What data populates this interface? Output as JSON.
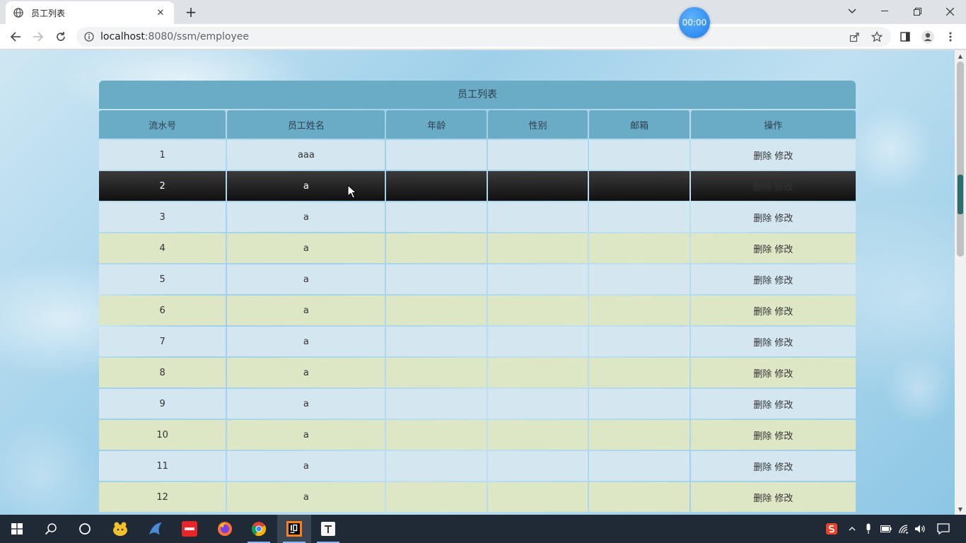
{
  "browser": {
    "tab_title": "员工列表",
    "tab_close": "✕",
    "new_tab": "+",
    "url_host": "localhost",
    "url_rest": ":8080/ssm/employee",
    "timer": "00:00"
  },
  "table": {
    "caption": "员工列表",
    "headers": [
      "流水号",
      "员工姓名",
      "年龄",
      "性别",
      "邮箱",
      "操作"
    ],
    "rows": [
      {
        "id": "1",
        "name": "aaa"
      },
      {
        "id": "2",
        "name": "a"
      },
      {
        "id": "3",
        "name": "a"
      },
      {
        "id": "4",
        "name": "a"
      },
      {
        "id": "5",
        "name": "a"
      },
      {
        "id": "6",
        "name": "a"
      },
      {
        "id": "7",
        "name": "a"
      },
      {
        "id": "8",
        "name": "a"
      },
      {
        "id": "9",
        "name": "a"
      },
      {
        "id": "10",
        "name": "a"
      },
      {
        "id": "11",
        "name": "a"
      },
      {
        "id": "12",
        "name": "a"
      }
    ],
    "delete_label": "删除",
    "edit_label": "修改"
  },
  "colors": {
    "header_bg": "#6aacc5",
    "row_light": "#d4e7f1",
    "row_olive": "#dde6c5",
    "row_hover": "#1a1a1a"
  },
  "taskbar": {
    "apps": [
      "start-icon",
      "search-icon",
      "cortana-icon",
      "app-yellow-icon",
      "app-blue-icon",
      "youdao-icon",
      "firefox-icon",
      "chrome-icon",
      "intellij-icon",
      "typora-icon"
    ],
    "tray": [
      "sogou-icon",
      "chevron-up-icon",
      "mic-icon",
      "battery-icon",
      "wifi-icon",
      "volume-icon",
      "notification-icon"
    ]
  }
}
